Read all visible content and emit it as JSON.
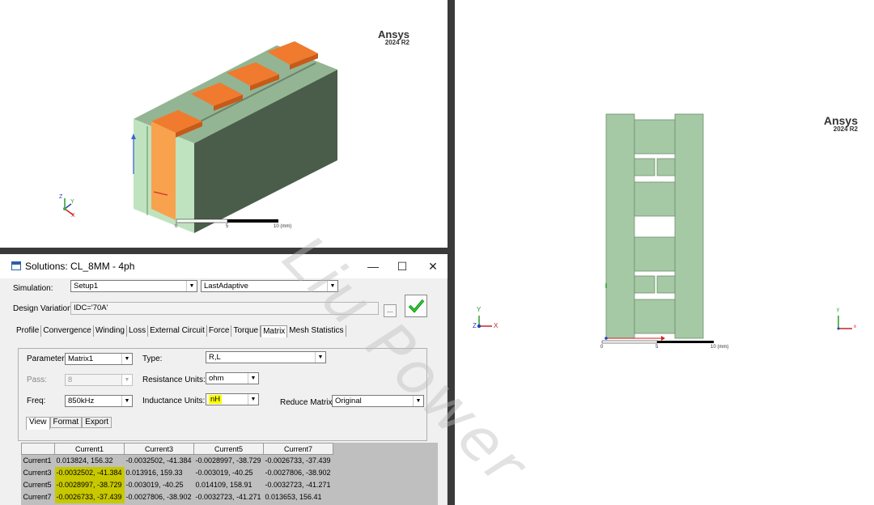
{
  "view3d": {
    "brand": {
      "name": "Ansys",
      "version": "2024 R2"
    },
    "scale": {
      "ticks": [
        "0",
        "5",
        "10 (mm)"
      ]
    },
    "triad": {
      "x": "X",
      "y": "Y",
      "z": "Z"
    }
  },
  "view2d": {
    "brand": {
      "name": "Ansys",
      "version": "2024 R2"
    },
    "scale": {
      "ticks": [
        "0",
        "5",
        "10 (mm)"
      ]
    },
    "triad_left": {
      "x": "X",
      "y": "Y",
      "z": "Z"
    },
    "triad_right": {
      "x": "x",
      "y": "y"
    }
  },
  "watermark": "Liu Power",
  "dialog": {
    "title": "Solutions: CL_8MM - 4ph",
    "window_buttons": {
      "minimize": "—",
      "maximize": "☐",
      "close": "✕"
    },
    "simulation_label": "Simulation:",
    "simulation_setup": "Setup1",
    "simulation_pass": "LastAdaptive",
    "design_variation_label": "Design Variation:",
    "design_variation_value": "IDC='70A'",
    "ellipsis_label": "...",
    "tabs": [
      "Profile",
      "Convergence",
      "Winding",
      "Loss",
      "External Circuit",
      "Force",
      "Torque",
      "Matrix",
      "Mesh Statistics"
    ],
    "active_tab": "Matrix",
    "parameter_label": "Parameter:",
    "parameter_value": "Matrix1",
    "type_label": "Type:",
    "type_value": "R,L",
    "pass_label": "Pass:",
    "pass_value": "8",
    "resistance_units_label": "Resistance Units:",
    "resistance_units_value": "ohm",
    "freq_label": "Freq:",
    "freq_value": "850kHz",
    "inductance_units_label": "Inductance Units:",
    "inductance_units_value": "nH",
    "reduce_matrix_label": "Reduce Matrix:",
    "reduce_matrix_value": "Original",
    "subtabs": [
      "View",
      "Format",
      "Export"
    ],
    "matrix": {
      "columns": [
        "Current1",
        "Current3",
        "Current5",
        "Current7"
      ],
      "rows": [
        {
          "name": "Current1",
          "cells": [
            "0.013824, 156.32",
            "-0.0032502, -41.384",
            "-0.0028997, -38.729",
            "-0.0026733, -37.439"
          ]
        },
        {
          "name": "Current3",
          "cells": [
            "-0.0032502, -41.384",
            "0.013916, 159.33",
            "-0.003019, -40.25",
            "-0.0027806, -38.902"
          ]
        },
        {
          "name": "Current5",
          "cells": [
            "-0.0028997, -38.729",
            "-0.003019, -40.25",
            "0.014109, 158.91",
            "-0.0032723, -41.271"
          ]
        },
        {
          "name": "Current7",
          "cells": [
            "-0.0026733, -37.439",
            "-0.0027806, -38.902",
            "-0.0032723, -41.271",
            "0.013653, 156.41"
          ]
        }
      ]
    }
  }
}
